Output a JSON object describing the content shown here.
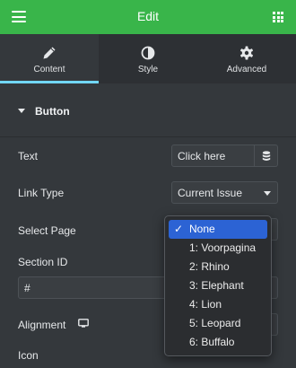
{
  "header": {
    "title": "Edit",
    "menu_icon": "hamburger-icon",
    "apps_icon": "grid-icon"
  },
  "tabs": [
    {
      "label": "Content",
      "icon": "pencil-icon",
      "active": true
    },
    {
      "label": "Style",
      "icon": "half-circle-icon",
      "active": false
    },
    {
      "label": "Advanced",
      "icon": "gear-icon",
      "active": false
    }
  ],
  "accent_color": "#71d7f7",
  "brand_color": "#39b54a",
  "section": {
    "title": "Button"
  },
  "fields": {
    "text": {
      "label": "Text",
      "value": "Click here"
    },
    "link_type": {
      "label": "Link Type",
      "value": "Current Issue"
    },
    "select_page": {
      "label": "Select Page"
    },
    "section_id": {
      "label": "Section ID",
      "value": "#"
    },
    "alignment": {
      "label": "Alignment"
    },
    "icon": {
      "label": "Icon"
    }
  },
  "dropdown": {
    "selected_color": "#2c63d4",
    "check_mark": "✓",
    "options": [
      "None",
      "1: Voorpagina",
      "2: Rhino",
      "3: Elephant",
      "4: Lion",
      "5: Leopard",
      "6: Buffalo"
    ]
  }
}
